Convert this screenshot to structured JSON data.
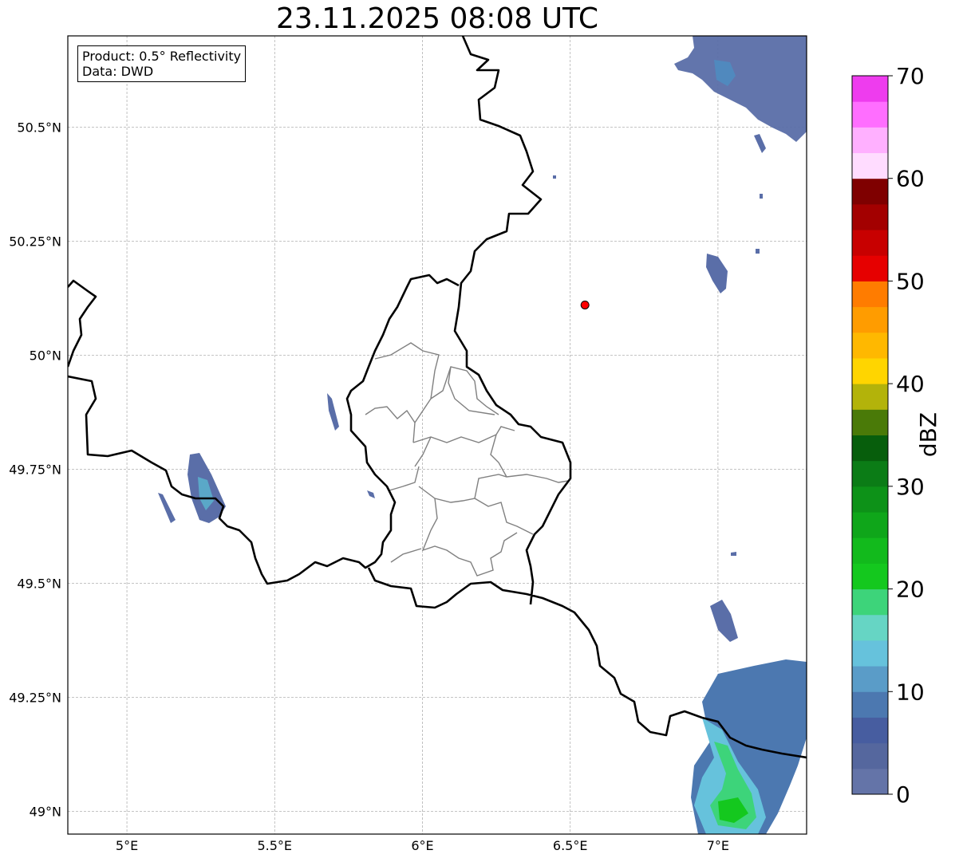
{
  "title": "23.11.2025 08:08 UTC",
  "info_box": {
    "product": "Product: 0.5° Reflectivity",
    "data": "Data: DWD"
  },
  "map": {
    "lon_range": [
      4.8,
      7.3
    ],
    "lat_range": [
      48.95,
      50.7
    ],
    "lon_ticks": [
      {
        "value": 5.0,
        "label": "5°E"
      },
      {
        "value": 5.5,
        "label": "5.5°E"
      },
      {
        "value": 6.0,
        "label": "6°E"
      },
      {
        "value": 6.5,
        "label": "6.5°E"
      },
      {
        "value": 7.0,
        "label": "7°E"
      }
    ],
    "lat_ticks": [
      {
        "value": 50.5,
        "label": "50.5°N"
      },
      {
        "value": 50.25,
        "label": "50.25°N"
      },
      {
        "value": 50.0,
        "label": "50°N"
      },
      {
        "value": 49.75,
        "label": "49.75°N"
      },
      {
        "value": 49.5,
        "label": "49.5°N"
      },
      {
        "value": 49.25,
        "label": "49.25°N"
      },
      {
        "value": 49.0,
        "label": "49°N"
      }
    ],
    "gridlines": true,
    "radar_site": {
      "lon": 6.55,
      "lat": 50.11,
      "color": "#ff0000"
    }
  },
  "colorbar": {
    "label": "dBZ",
    "min": 0,
    "max": 70,
    "step": 2.5,
    "tick_values": [
      0,
      10,
      20,
      30,
      40,
      50,
      60,
      70
    ],
    "tick_labels": [
      "0",
      "10",
      "20",
      "30",
      "40",
      "50",
      "60",
      "70"
    ],
    "colors": [
      "#6474a8",
      "#55679e",
      "#475da0",
      "#4c78b0",
      "#5a9cc8",
      "#66c2dc",
      "#66d5c4",
      "#3dd47a",
      "#14c81e",
      "#12ba1c",
      "#0fa61a",
      "#0d9218",
      "#0b7c16",
      "#075e0c",
      "#4a7a08",
      "#b3b30a",
      "#ffd500",
      "#ffb800",
      "#ff9c00",
      "#ff7c00",
      "#e60000",
      "#c80000",
      "#a30000",
      "#7f0000",
      "#ffdcff",
      "#ffb0ff",
      "#ff6eff",
      "#ee3cee"
    ]
  }
}
